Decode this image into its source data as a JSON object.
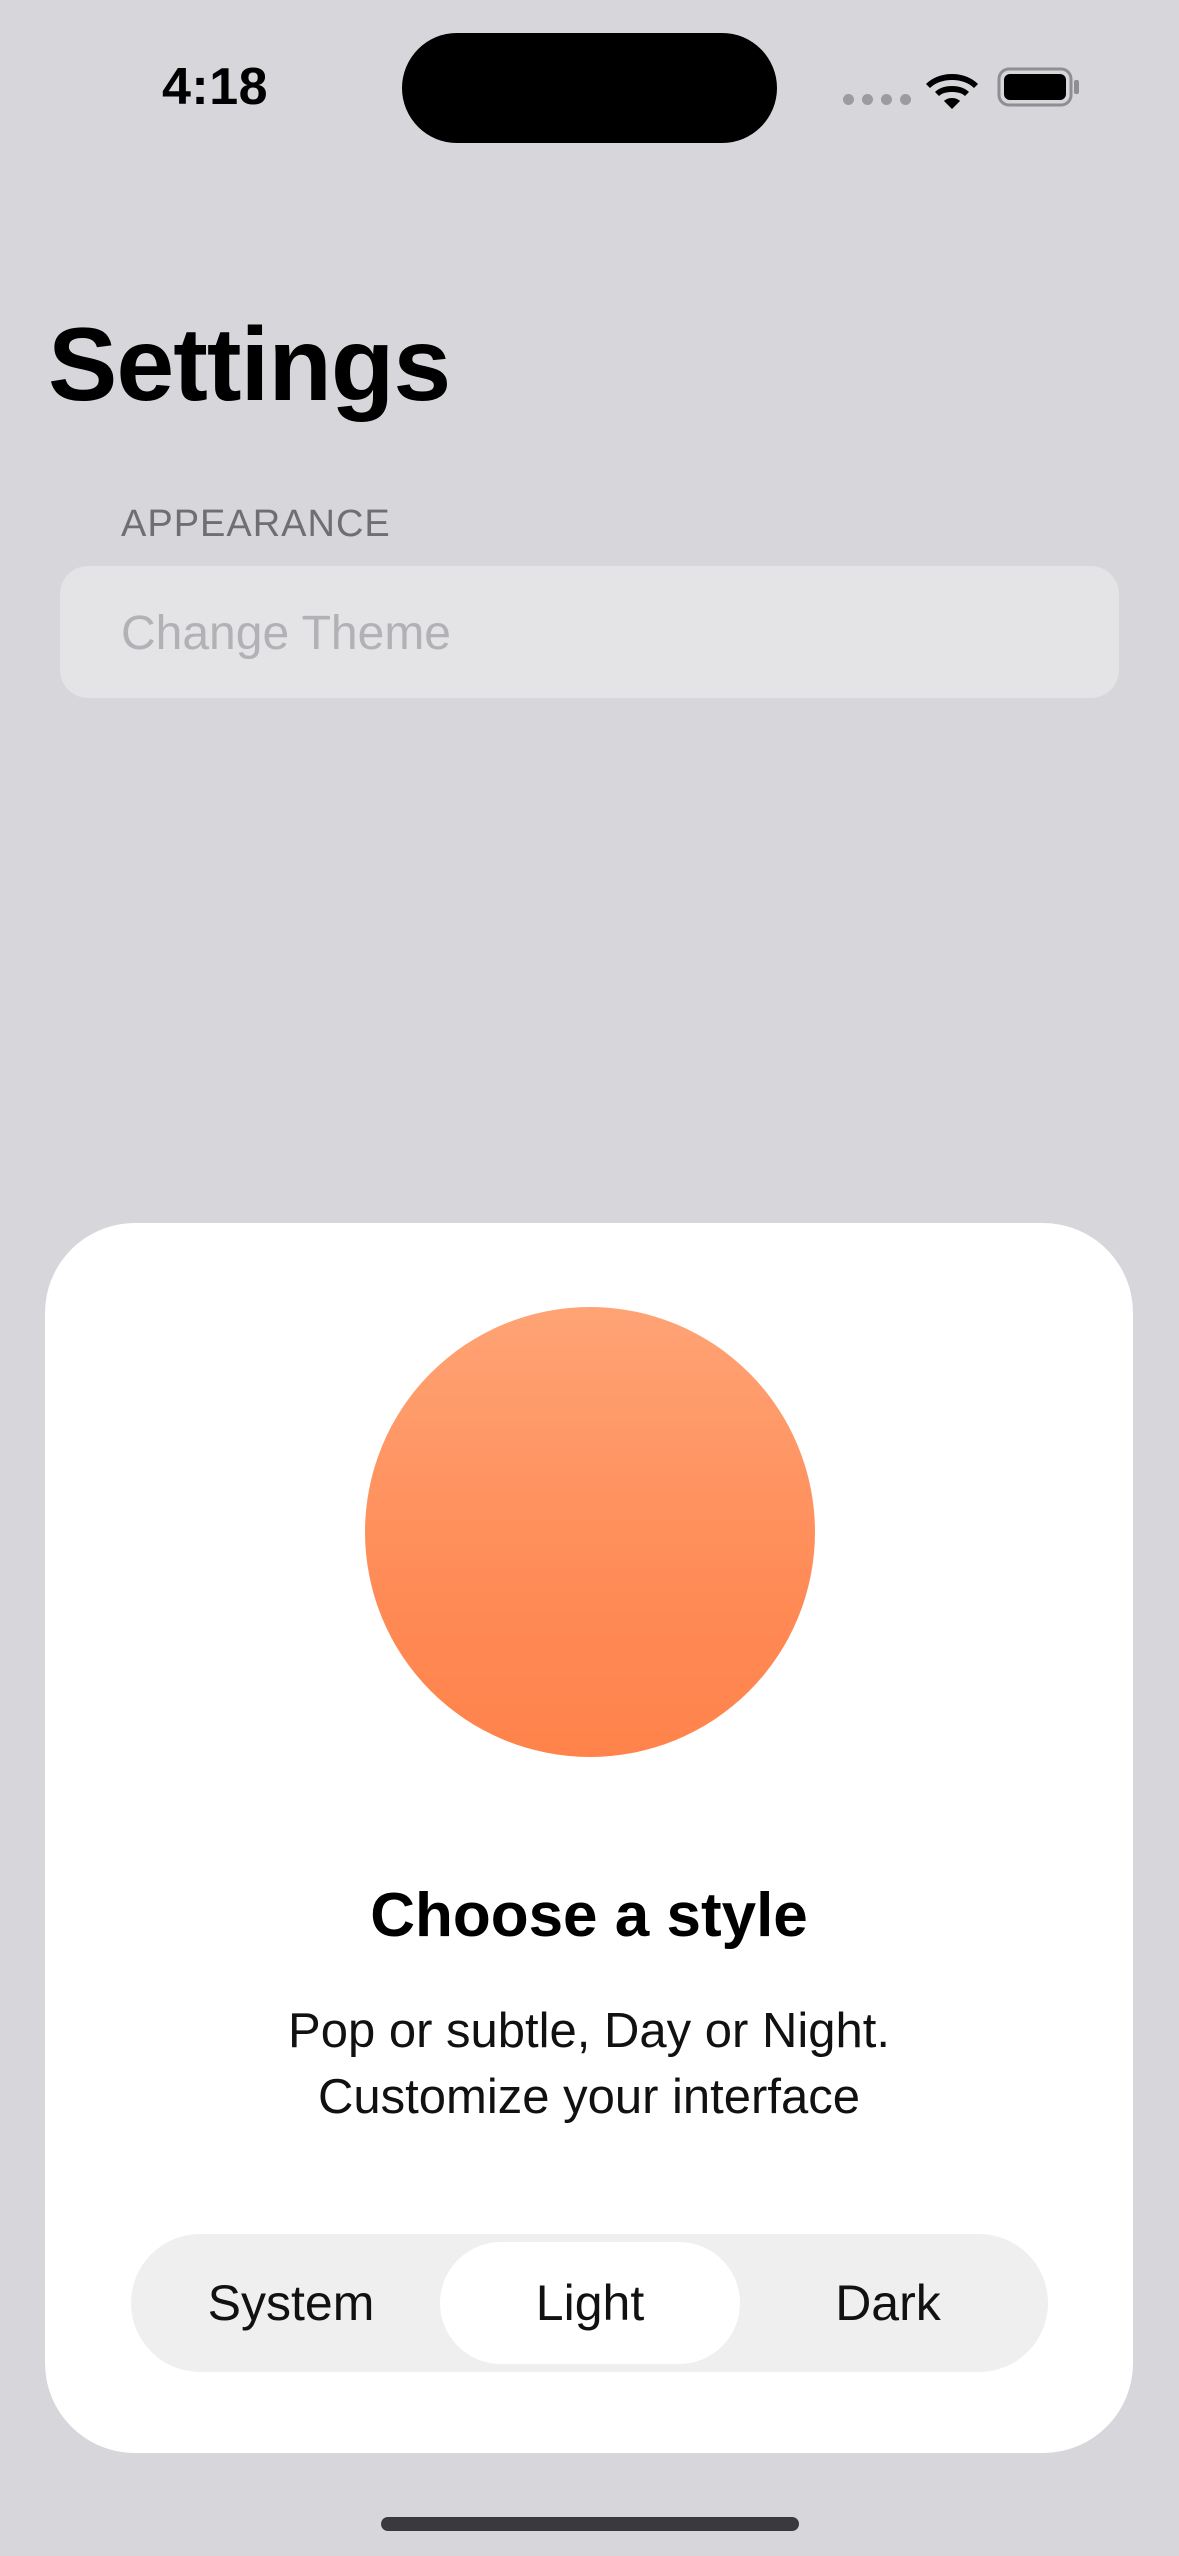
{
  "status_bar": {
    "time": "4:18",
    "icons": [
      "signal-icon",
      "wifi-icon",
      "battery-icon"
    ]
  },
  "header": {
    "title": "Settings"
  },
  "appearance": {
    "section_label": "APPEARANCE",
    "row_label": "Change Theme"
  },
  "sheet": {
    "title": "Choose a style",
    "subtitle_line1": "Pop or subtle, Day or Night.",
    "subtitle_line2": "Customize your interface",
    "accent_color": "#ff8a55",
    "options": [
      {
        "label": "System",
        "selected": false
      },
      {
        "label": "Light",
        "selected": true
      },
      {
        "label": "Dark",
        "selected": false
      }
    ]
  }
}
